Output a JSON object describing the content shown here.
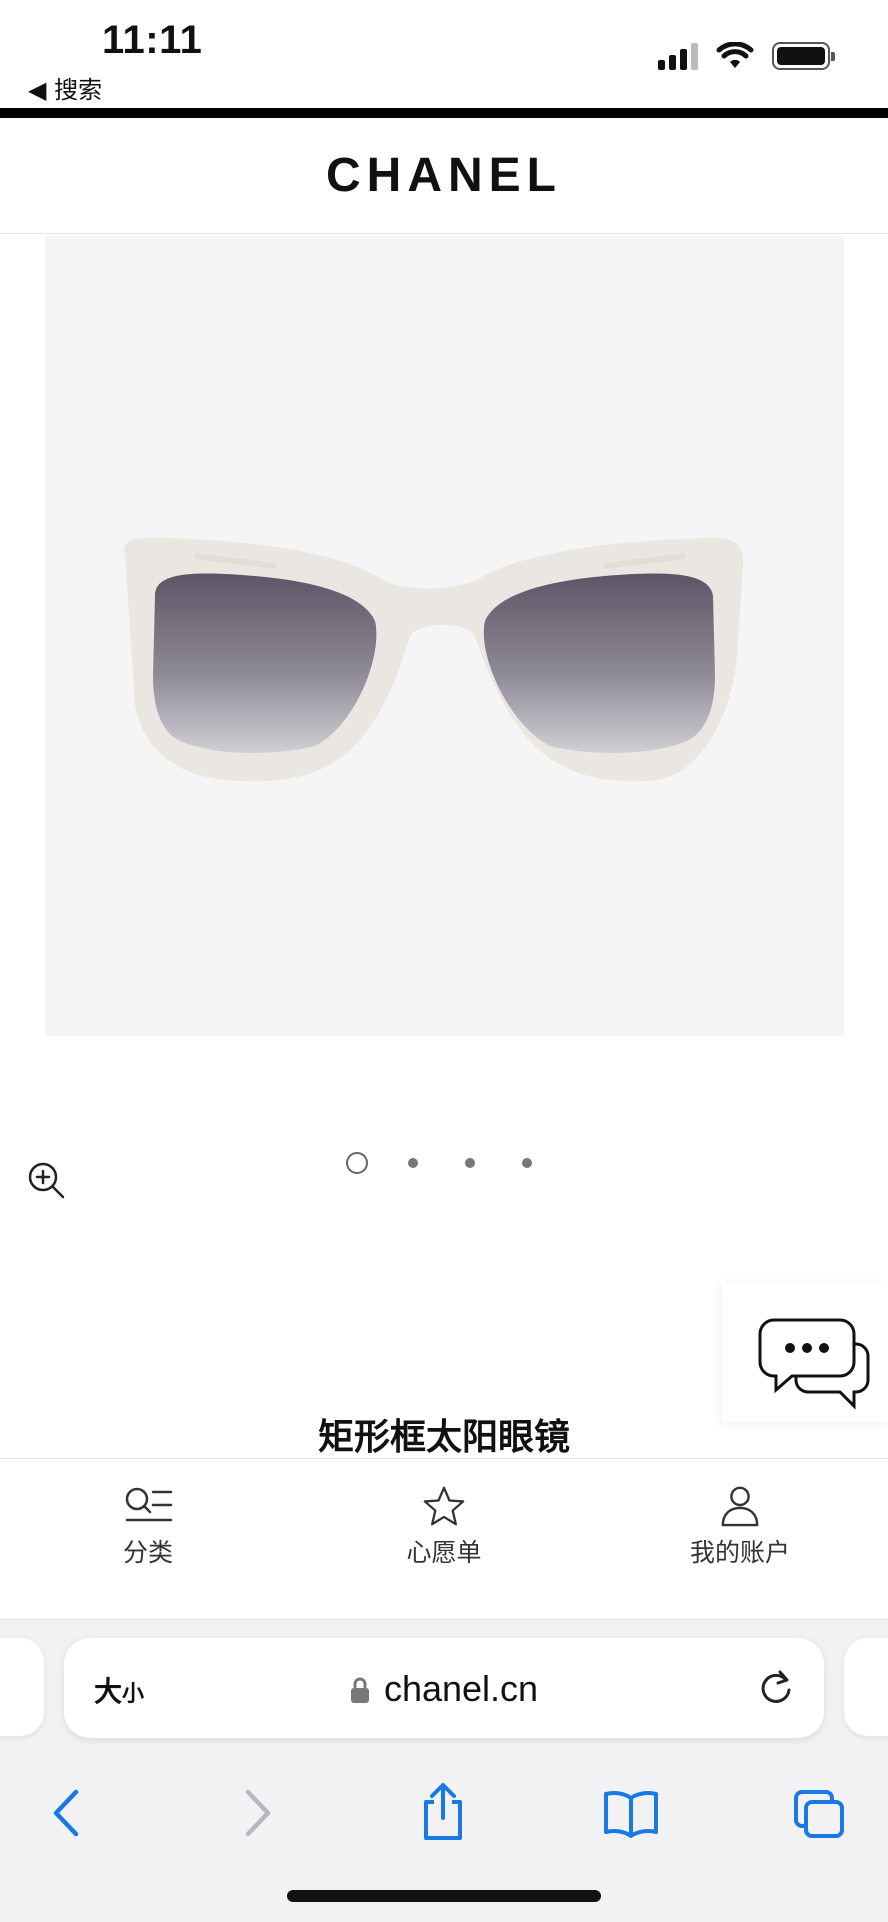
{
  "status_bar": {
    "time": "11:11",
    "back_label": "◀ 搜索"
  },
  "header": {
    "brand": "CHANEL"
  },
  "product": {
    "image_alt": "white rectangular sunglasses with gradient lenses",
    "carousel_total": 4,
    "carousel_active": 1,
    "title": "矩形框太阳眼镜"
  },
  "bottom_nav": {
    "items": [
      {
        "label": "分类",
        "icon": "category-list-icon"
      },
      {
        "label": "心愿单",
        "icon": "star-icon"
      },
      {
        "label": "我的账户",
        "icon": "user-icon"
      }
    ]
  },
  "browser": {
    "text_size_label": "大",
    "text_size_small": "小",
    "url": "chanel.cn"
  },
  "colors": {
    "accent": "#1a78e5",
    "image_bg": "#f5f5f5",
    "frame": "#eae7e3"
  }
}
